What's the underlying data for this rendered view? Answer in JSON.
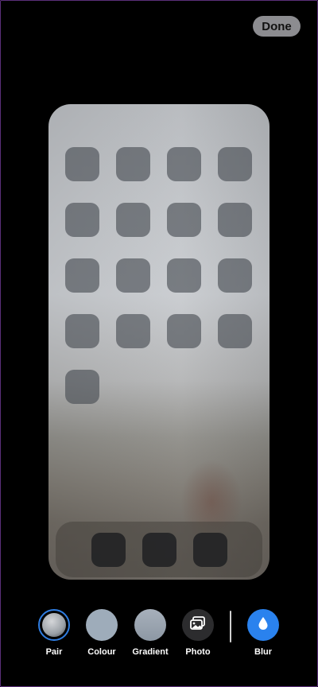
{
  "header": {
    "done_label": "Done"
  },
  "home_preview": {
    "app_rows": [
      4,
      4,
      4,
      4,
      1
    ],
    "dock_apps": 3
  },
  "toolbar": {
    "options": [
      {
        "key": "pair",
        "label": "Pair",
        "selected": true
      },
      {
        "key": "colour",
        "label": "Colour",
        "selected": false
      },
      {
        "key": "gradient",
        "label": "Gradient",
        "selected": false
      },
      {
        "key": "photo",
        "label": "Photo",
        "icon": "photo-gallery-icon",
        "selected": false
      },
      {
        "key": "blur",
        "label": "Blur",
        "icon": "water-drop-icon",
        "selected": false
      }
    ]
  },
  "colors": {
    "accent": "#2a82ee",
    "selection_ring": "#2f7de1",
    "done_bg": "#8c8c90"
  }
}
